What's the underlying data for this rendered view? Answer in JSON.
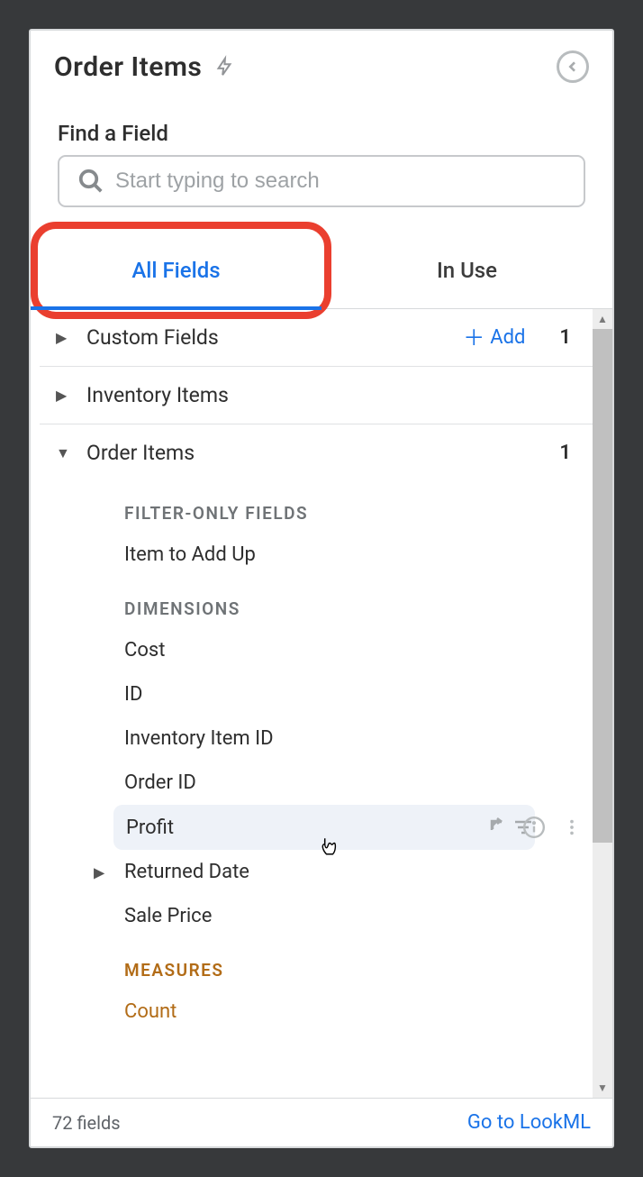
{
  "header": {
    "title": "Order Items"
  },
  "search": {
    "label": "Find a Field",
    "placeholder": "Start typing to search"
  },
  "tabs": {
    "all_fields": "All Fields",
    "in_use": "In Use"
  },
  "sections": {
    "custom_fields": {
      "name": "Custom Fields",
      "add_label": "Add",
      "count": "1"
    },
    "inventory_items": {
      "name": "Inventory Items"
    },
    "order_items": {
      "name": "Order Items",
      "count": "1",
      "filter_only_label": "FILTER-ONLY FIELDS",
      "filter_only_items": [
        "Item to Add Up"
      ],
      "dimensions_label": "DIMENSIONS",
      "dimensions_items": [
        "Cost",
        "ID",
        "Inventory Item ID",
        "Order ID",
        "Profit",
        "Returned Date",
        "Sale Price"
      ],
      "measures_label": "MEASURES",
      "measures_items": [
        "Count"
      ]
    }
  },
  "footer": {
    "count_text": "72 fields",
    "lookml_link": "Go to LookML"
  }
}
